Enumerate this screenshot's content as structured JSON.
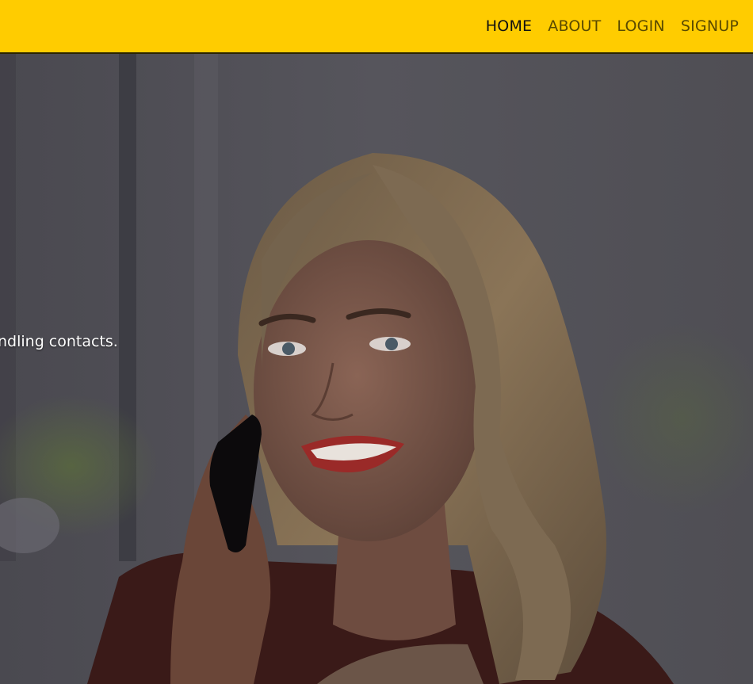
{
  "nav": {
    "items": [
      {
        "label": "HOME",
        "active": true
      },
      {
        "label": "ABOUT",
        "active": false
      },
      {
        "label": "LOGIN",
        "active": false
      },
      {
        "label": "SIGNUP",
        "active": false
      }
    ]
  },
  "hero": {
    "tagline": "ndling contacts."
  },
  "colors": {
    "navbar": "#ffcc00",
    "overlay": "#3b3a40"
  }
}
